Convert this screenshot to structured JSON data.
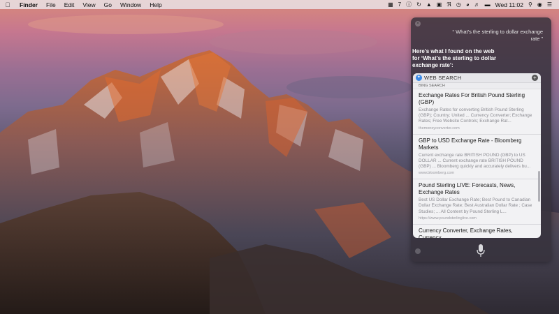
{
  "menubar": {
    "apple_icon": "apple-icon",
    "app_name": "Finder",
    "menus": [
      "File",
      "Edit",
      "View",
      "Go",
      "Window",
      "Help"
    ],
    "status": {
      "notification_count": "7",
      "clock": "Wed 11:02"
    }
  },
  "siri": {
    "query": "“ What’s the sterling to dollar exchange rate ”",
    "response": "Here’s what I found on the web for ‘What’s the sterling to dollar exchange rate’:",
    "card": {
      "header": "WEB SEARCH",
      "subheader": "BING SEARCH",
      "results": [
        {
          "title": "Exchange Rates For British Pound Sterling (GBP)",
          "desc": "Exchange Rates for converting British Pound Sterling (GBP); Country; United ... Currency Converter; Exchange Rates; Free Website Controls; Exchange Rat...",
          "url": "themoneyconverter.com"
        },
        {
          "title": "GBP to USD Exchange Rate - Bloomberg Markets",
          "desc": "Current exchange rate BRITISH POUND (GBP) to US DOLLAR ... Current exchange rate BRITISH POUND (GBP) ... Bloomberg quickly and accurately delivers bu...",
          "url": "www.bloomberg.com"
        },
        {
          "title": "Pound Sterling LIVE: Forecasts, News, Exchange Rates",
          "desc": "Best US Dollar Exchange Rate; Best Pound to Canadian Dollar Exchange Rate; Best Australian Dollar Rate ; Case Studies; ... All Content by Pound Sterling L...",
          "url": "https://www.poundsterlinglive.com"
        },
        {
          "title": "Currency Converter, Exchange Rates, Currency",
          "desc": "",
          "url": ""
        }
      ]
    }
  }
}
